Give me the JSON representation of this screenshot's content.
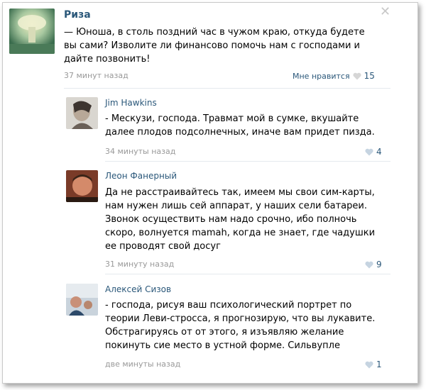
{
  "post": {
    "author": "Риза",
    "text": "— Юноша, в столь поздний час в чужом краю, откуда будете\nвы сами? Изволите ли финансово помочь нам с господами и\nдайте позвонить!",
    "time": "37 минут назад",
    "like_label": "Мне нравится",
    "like_count": "15"
  },
  "comments": [
    {
      "author": "Jim Hawkins",
      "text": "- Мескузи, господа. Травмат мой в сумке, вкушайте\nдалее плодов подсолнечных, иначе вам придет пизда.",
      "time": "34 минуты назад",
      "likes": "4"
    },
    {
      "author": "Леон Фанерный",
      "text": "Да не расстраивайтесь так, имеем мы свои сим-карты,\nнам нужен лишь сей аппарат, у наших сели батареи.\nЗвонок осуществить нам надо срочно, ибо полночь\nскоро, волнуется mamah, когда не знает, где чадушки\nее проводят свой досуг",
      "time": "31 минуту назад",
      "likes": "9"
    },
    {
      "author": "Алексей Сизов",
      "text": "- господа, рисуя ваш психологический портрет по\nтеории Леви-стросса, я прогнозирую, что вы лукавите.\nОбстрагируясь от от этого, я изъявляю желание\nпокинуть сие место в устной форме. Сильвупле",
      "time": "две минуты назад",
      "likes": "1"
    }
  ],
  "colors": {
    "link": "#2b587a",
    "time": "#999999",
    "heart": "#c6d4e1"
  }
}
